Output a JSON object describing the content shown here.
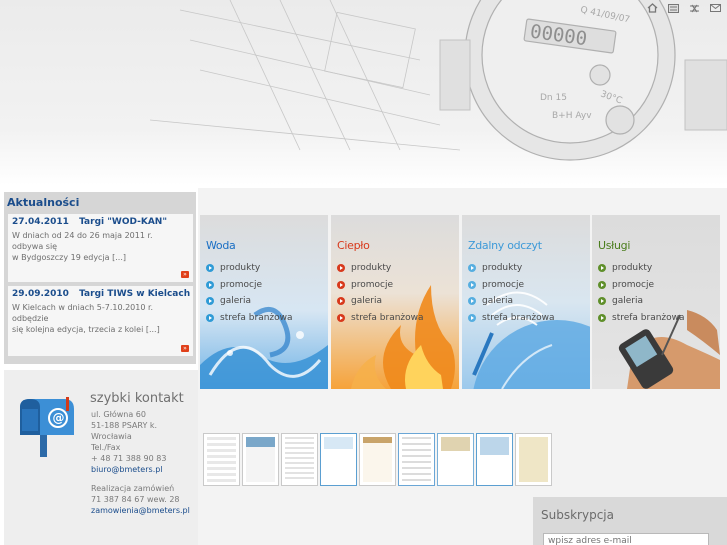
{
  "top_icons": [
    "home-icon",
    "sitemap-icon",
    "language-icon",
    "mail-icon"
  ],
  "news": {
    "title": "Aktualności",
    "items": [
      {
        "date": "27.04.2011",
        "title": "Targi \"WOD-KAN\"",
        "lines": [
          "W dniach od 24 do 26 maja 2011 r.",
          "odbywa się",
          "w Bydgoszczy 19 edycja  [...]"
        ]
      },
      {
        "date": "29.09.2010",
        "title": "Targi TIWS w Kielcach",
        "lines": [
          "W Kielcach w dniach 5-7.10.2010 r.",
          "odbędzie",
          "się kolejna edycja, trzecia z kolei  [...]"
        ]
      }
    ]
  },
  "contact": {
    "title": "szybki kontakt",
    "address1": "ul. Główna 60",
    "address2": "51-188 PSARY k.",
    "address3": "Wrocławia",
    "phone_label": "Tel./Fax",
    "phone": "+ 48 71 388 90 83",
    "email": "biuro@bmeters.pl",
    "orders_label": "Realizacja zamówień",
    "orders_phone": "71 387 84 67 wew. 28",
    "orders_email": "zamowienia@bmeters.pl"
  },
  "tiles": [
    {
      "title": "Woda",
      "color": "#1a6fc4",
      "bullet_color": "#2f9bd6",
      "links": [
        "produkty",
        "promocje",
        "galeria",
        "strefa branżowa"
      ]
    },
    {
      "title": "Ciepło",
      "color": "#d8391c",
      "bullet_color": "#d8391c",
      "links": [
        "produkty",
        "promocje",
        "galeria",
        "strefa branżowa"
      ]
    },
    {
      "title": "Zdalny odczyt",
      "color": "#3e9ad8",
      "bullet_color": "#56aee0",
      "links": [
        "produkty",
        "promocje",
        "galeria",
        "strefa branżowa"
      ]
    },
    {
      "title": "Usługi",
      "color": "#4a7d1c",
      "bullet_color": "#5f8f2a",
      "links": [
        "produkty",
        "promocje",
        "galeria",
        "strefa branżowa"
      ]
    }
  ],
  "certificates": 9,
  "subscribe": {
    "title": "Subskrypcja",
    "placeholder": "wpisz adres e-mail"
  }
}
